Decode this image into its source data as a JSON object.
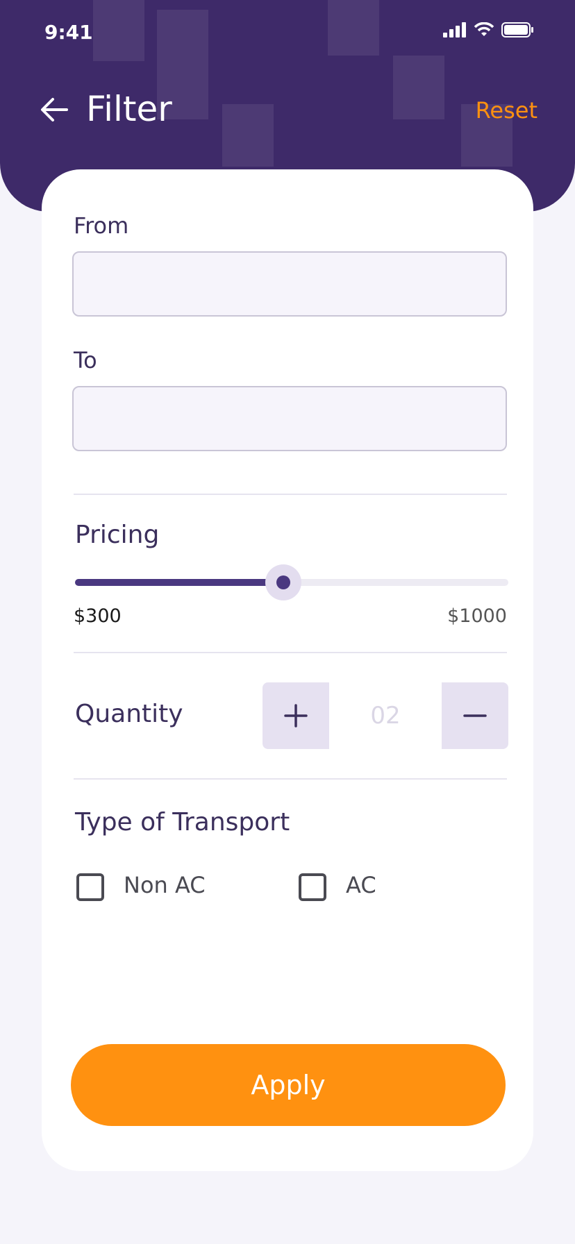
{
  "status_bar": {
    "time": "9:41"
  },
  "header": {
    "title": "Filter",
    "reset_label": "Reset"
  },
  "form": {
    "from": {
      "label": "From",
      "value": "",
      "placeholder": ""
    },
    "to": {
      "label": "To",
      "value": "",
      "placeholder": ""
    }
  },
  "pricing": {
    "title": "Pricing",
    "min_label": "$300",
    "max_label": "$1000",
    "level_fraction": 0.48
  },
  "quantity": {
    "title": "Quantity",
    "value": "02"
  },
  "transport": {
    "title": "Type of Transport",
    "options": [
      {
        "label": "Non AC",
        "checked": false
      },
      {
        "label": "AC",
        "checked": false
      }
    ]
  },
  "actions": {
    "apply_label": "Apply"
  },
  "colors": {
    "primary": "#3E2A69",
    "accent": "#FF9110",
    "slider": "#4A3880"
  }
}
